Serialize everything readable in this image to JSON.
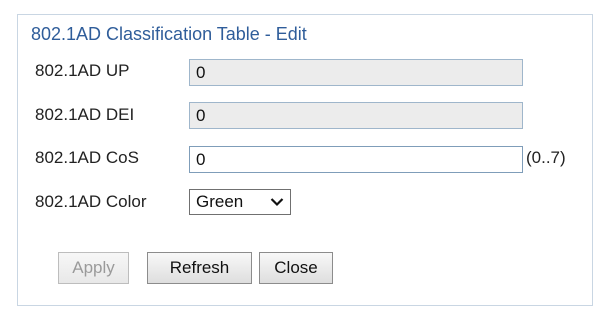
{
  "dialog": {
    "title": "802.1AD Classification Table - Edit"
  },
  "fields": {
    "up": {
      "label": "802.1AD UP",
      "value": "0"
    },
    "dei": {
      "label": "802.1AD DEI",
      "value": "0"
    },
    "cos": {
      "label": "802.1AD CoS",
      "value": "0",
      "hint": "(0..7)"
    },
    "color": {
      "label": "802.1AD Color",
      "selected": "Green"
    }
  },
  "buttons": {
    "apply": "Apply",
    "refresh": "Refresh",
    "close": "Close"
  }
}
